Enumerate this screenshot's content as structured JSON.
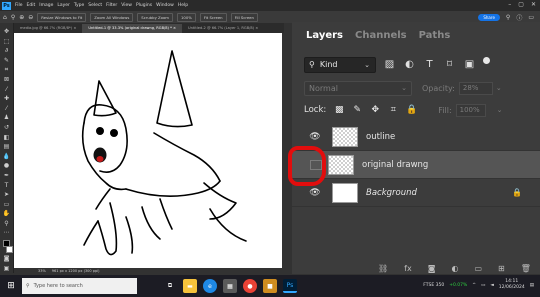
{
  "menubar": {
    "logo": "Ps",
    "items": [
      "File",
      "Edit",
      "Image",
      "Layer",
      "Type",
      "Select",
      "Filter",
      "View",
      "Plugins",
      "Window",
      "Help"
    ],
    "window_controls": [
      "–",
      "▢",
      "✕"
    ]
  },
  "options": {
    "zoom_pills": [
      "Resize Windows to Fit",
      "Zoom All Windows",
      "Scrubby Zoom",
      "100%",
      "Fit Screen",
      "Fill Screen"
    ],
    "share_label": "Share"
  },
  "doc_tabs": [
    {
      "label": "media.jpg @ 66.7% (RGB/8*) ×",
      "active": false
    },
    {
      "label": "Untitled-1 @ 33.3% (original drawng, RGB/8) * ×",
      "active": true
    },
    {
      "label": "Untitled-2 @ 66.7% (Layer 1, RGB/8) ×",
      "active": false
    }
  ],
  "status": {
    "zoom": "33%",
    "doc_info": "961 px x 1200 px (300 ppi)"
  },
  "layers_panel": {
    "tabs": [
      {
        "label": "Layers",
        "active": true
      },
      {
        "label": "Channels",
        "active": false
      },
      {
        "label": "Paths",
        "active": false
      }
    ],
    "filter_kind": "Kind",
    "blend_mode": "Normal",
    "opacity_label": "Opacity:",
    "opacity_value": "28%",
    "lock_label": "Lock:",
    "fill_label": "Fill:",
    "fill_value": "100%",
    "layers": [
      {
        "name": "outline",
        "visible": true,
        "selected": false,
        "italic": false,
        "locked": false
      },
      {
        "name": "original drawng",
        "visible": false,
        "selected": true,
        "italic": false,
        "locked": false
      },
      {
        "name": "Background",
        "visible": true,
        "selected": false,
        "italic": true,
        "locked": true
      }
    ]
  },
  "taskbar": {
    "search_placeholder": "Type here to search",
    "stock_label": "FTSE 350",
    "stock_change": "+0.07%",
    "time": "14:11",
    "date": "12/06/2024"
  },
  "colors": {
    "accent_blue": "#1473e6",
    "annotation_red": "#e20d0d",
    "panel_bg": "#3c3c3c",
    "selected_row": "#555555"
  }
}
